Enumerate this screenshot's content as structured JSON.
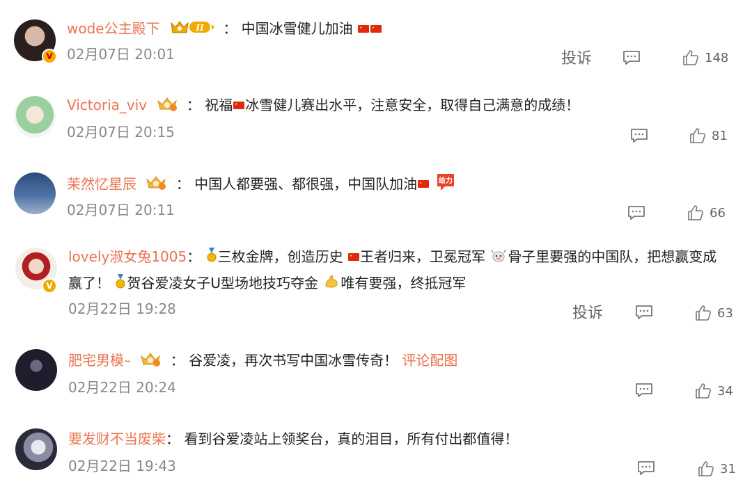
{
  "comments": [
    {
      "username": "wode公主殿下",
      "text": "：  中国冰雪健儿加油",
      "time": "02月07日 20:01",
      "report": "投诉",
      "likes": "148"
    },
    {
      "username": "Victoria_viv",
      "text": "：  祝福",
      "text2": "冰雪健儿赛出水平，注意安全，取得自己满意的成绩！",
      "time": "02月07日 20:15",
      "likes": "81"
    },
    {
      "username": "茉然忆星辰",
      "text": "：  中国人都要强、都很强，中国队加油",
      "time": "02月07日 20:11",
      "likes": "66"
    },
    {
      "username": "lovely淑女兔1005",
      "text_a": "：",
      "text_b": "三枚金牌，创造历史 ",
      "text_c": "王者归来，卫冕冠军 ",
      "text_d": "骨子里要强的中国队，把想赢变成",
      "line2_a": "赢了！ ",
      "line2_b": "贺谷爱凌女子U型场地技巧夺金 ",
      "line2_c": "唯有要强，终抵冠军",
      "time": "02月22日 19:28",
      "report": "投诉",
      "likes": "63"
    },
    {
      "username": "肥宅男模–",
      "text": "：  谷爱凌，再次书写中国冰雪传奇！ ",
      "pic_link": "评论配图",
      "time": "02月22日 20:24",
      "likes": "34"
    },
    {
      "username": "要发财不当废柴",
      "text": "：  看到谷爱凌站上领奖台，真的泪目，所有付出都值得！",
      "time": "02月22日 19:43",
      "likes": "31"
    }
  ],
  "badges": {
    "vip_level": "II",
    "avatar_v": "V",
    "cheer_sticker": "给力"
  },
  "colors": {
    "username": "#eb7350",
    "text": "#222222",
    "meta": "#888888",
    "gold": "#f2a900"
  }
}
